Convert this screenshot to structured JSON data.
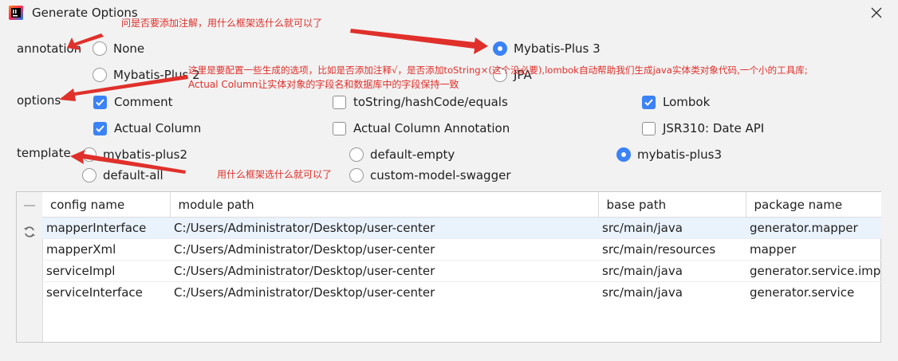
{
  "window": {
    "title": "Generate Options",
    "close_glyph": "✕"
  },
  "annotation": {
    "label": "annotation",
    "options": [
      {
        "label": "None",
        "checked": false
      },
      {
        "label": "Mybatis-Plus 3",
        "checked": true
      },
      {
        "label": "Mybatis-Plus 2",
        "checked": false
      },
      {
        "label": "JPA",
        "checked": false
      }
    ]
  },
  "options": {
    "label": "options",
    "items": [
      {
        "label": "Comment",
        "checked": true
      },
      {
        "label": "toString/hashCode/equals",
        "checked": false
      },
      {
        "label": "Lombok",
        "checked": true
      },
      {
        "label": "Actual Column",
        "checked": true
      },
      {
        "label": "Actual Column Annotation",
        "checked": false
      },
      {
        "label": "JSR310: Date API",
        "checked": false
      }
    ]
  },
  "template": {
    "label": "template",
    "options": [
      {
        "label": "mybatis-plus2",
        "checked": false
      },
      {
        "label": "default-empty",
        "checked": false
      },
      {
        "label": "mybatis-plus3",
        "checked": true
      },
      {
        "label": "default-all",
        "checked": false
      },
      {
        "label": "custom-model-swagger",
        "checked": false
      }
    ]
  },
  "table": {
    "headers": [
      "config name",
      "module path",
      "base path",
      "package name"
    ],
    "rows": [
      [
        "mapperInterface",
        "C:/Users/Administrator/Desktop/user-center",
        "src/main/java",
        "generator.mapper"
      ],
      [
        "mapperXml",
        "C:/Users/Administrator/Desktop/user-center",
        "src/main/resources",
        "mapper"
      ],
      [
        "serviceImpl",
        "C:/Users/Administrator/Desktop/user-center",
        "src/main/java",
        "generator.service.impl"
      ],
      [
        "serviceInterface",
        "C:/Users/Administrator/Desktop/user-center",
        "src/main/java",
        "generator.service"
      ]
    ]
  },
  "notes": {
    "annotation_note": "问是否要添加注解，用什么框架选什么就可以了",
    "options_note_line1": "这里是要配置一些生成的选项，比如是否添加注释√，是否添加toString×(这个没必要),lombok自动帮助我们生成java实体类对象代码,一个小的工具库;",
    "options_note_line2": "Actual Column让实体对象的字段名和数据库中的字段保持一致",
    "template_note": "用什么框架选什么就可以了"
  },
  "colors": {
    "accent": "#3b82f6",
    "annotation_red": "#e0302b",
    "selected_row": "#eaf2fc"
  },
  "icons": {
    "app": "intellij-idea-icon",
    "close": "close-icon",
    "remove": "minus-icon",
    "refresh": "refresh-icon"
  }
}
